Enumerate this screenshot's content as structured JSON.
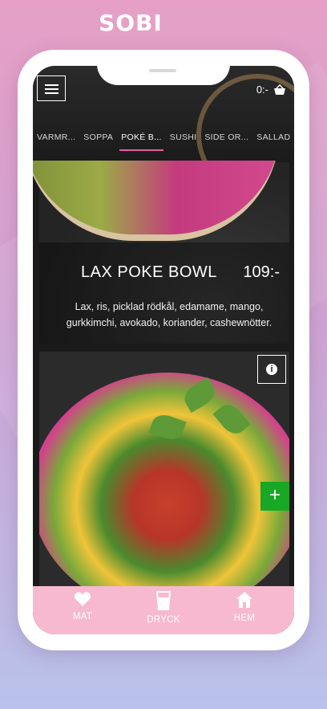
{
  "app": {
    "logo_text": "SOBI"
  },
  "header": {
    "cart_total": "0:-"
  },
  "tabs": [
    {
      "label": "VARMR..."
    },
    {
      "label": "SOPPA"
    },
    {
      "label": "POKÉ B..."
    },
    {
      "label": "SUSHI"
    },
    {
      "label": "SIDE OR..."
    },
    {
      "label": "SALLAD"
    }
  ],
  "active_tab": "POKÉ B...",
  "products": [
    {
      "name": "LAX POKE BOWL",
      "price": "109:-",
      "description": "Lax, ris, picklad rödkål, edamame, mango, gurkkimchi, avokado, koriander, cashewnötter."
    }
  ],
  "bottom_nav": [
    {
      "label": "MAT",
      "icon": "heart-icon"
    },
    {
      "label": "DRYCK",
      "icon": "cup-icon"
    },
    {
      "label": "HEM",
      "icon": "home-icon"
    }
  ],
  "colors": {
    "accent": "#e85aa0",
    "nav_bg": "#f7b9cf",
    "add_button": "#18a825"
  }
}
